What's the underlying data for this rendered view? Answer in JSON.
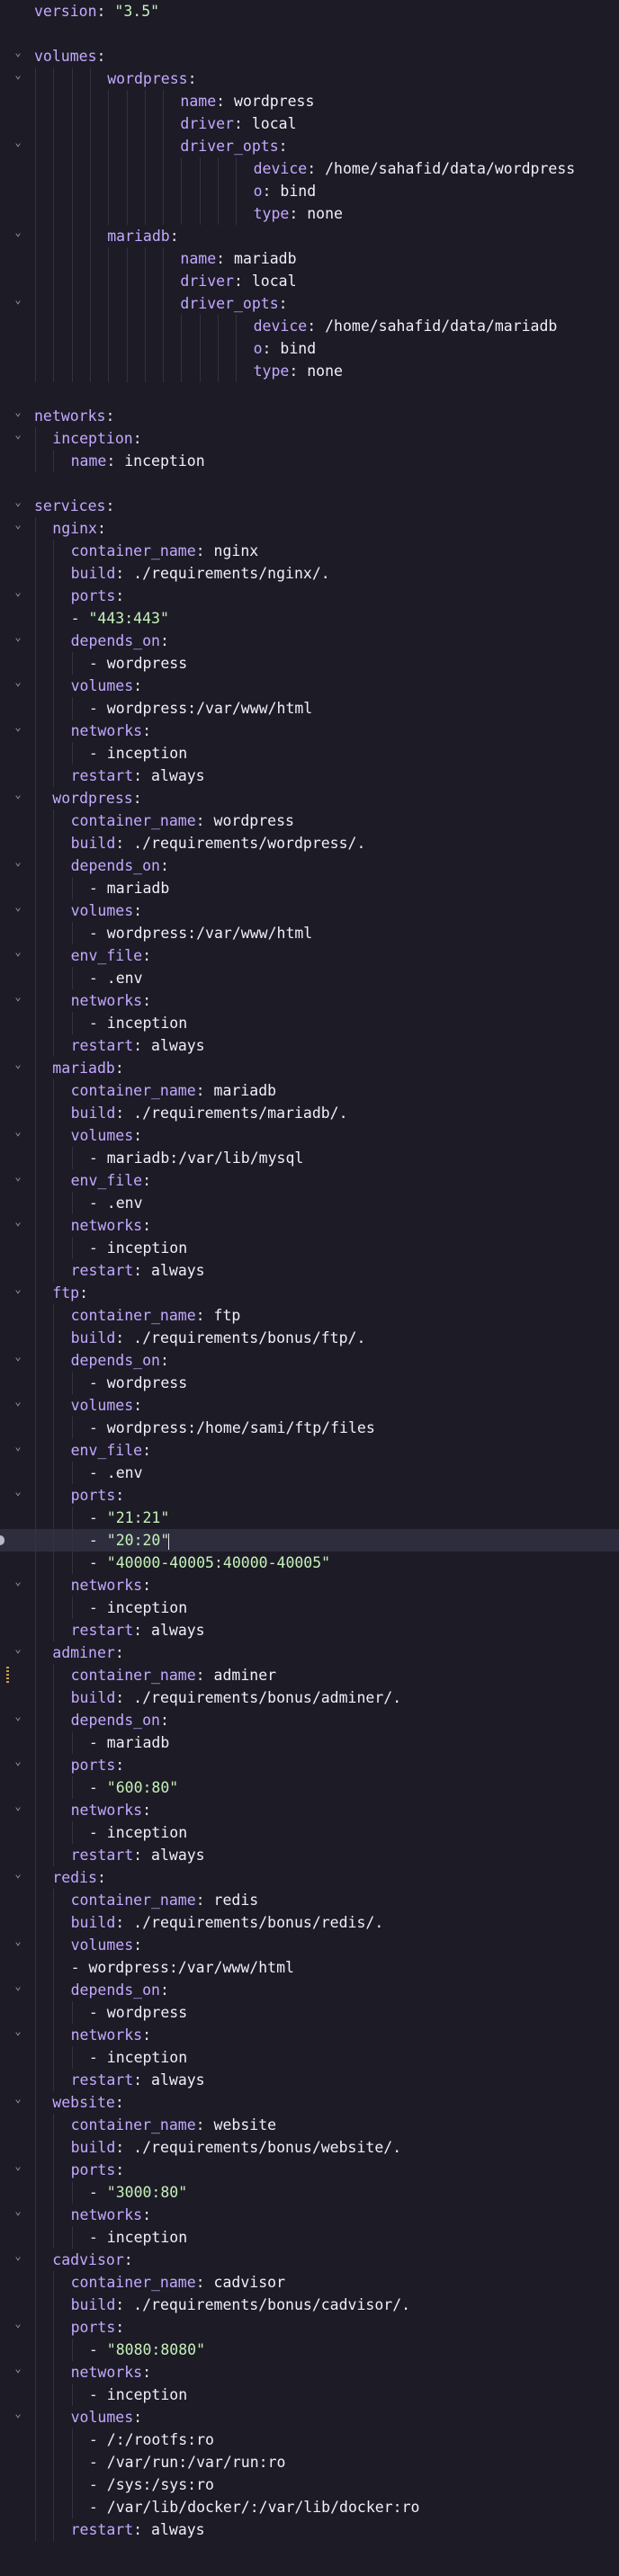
{
  "lines": [
    {
      "k": "version",
      "s": "\"3.5\""
    },
    {},
    {
      "k": "volumes",
      "fold": true
    },
    {
      "depth": 4,
      "k": "wordpress",
      "fold": true
    },
    {
      "depth": 8,
      "k": "name",
      "v": "wordpress"
    },
    {
      "depth": 8,
      "k": "driver",
      "v": "local"
    },
    {
      "depth": 8,
      "k": "driver_opts",
      "fold": true
    },
    {
      "depth": 12,
      "k": "device",
      "v": "/home/sahafid/data/wordpress"
    },
    {
      "depth": 12,
      "k": "o",
      "v": "bind"
    },
    {
      "depth": 12,
      "k": "type",
      "v": "none"
    },
    {
      "depth": 4,
      "k": "mariadb",
      "fold": true
    },
    {
      "depth": 8,
      "k": "name",
      "v": "mariadb"
    },
    {
      "depth": 8,
      "k": "driver",
      "v": "local"
    },
    {
      "depth": 8,
      "k": "driver_opts",
      "fold": true
    },
    {
      "depth": 12,
      "k": "device",
      "v": "/home/sahafid/data/mariadb"
    },
    {
      "depth": 12,
      "k": "o",
      "v": "bind"
    },
    {
      "depth": 12,
      "k": "type",
      "v": "none"
    },
    {},
    {
      "k": "networks",
      "fold": true
    },
    {
      "depth": 1,
      "k": "inception",
      "fold": true
    },
    {
      "depth": 2,
      "k": "name",
      "v": "inception"
    },
    {},
    {
      "k": "services",
      "fold": true
    },
    {
      "depth": 1,
      "k": "nginx",
      "fold": true
    },
    {
      "depth": 2,
      "k": "container_name",
      "v": "nginx"
    },
    {
      "depth": 2,
      "k": "build",
      "v": "./requirements/nginx/."
    },
    {
      "depth": 2,
      "k": "ports",
      "fold": true
    },
    {
      "depth": 2,
      "dash": true,
      "s": "\"443:443\""
    },
    {
      "depth": 2,
      "k": "depends_on",
      "fold": true
    },
    {
      "depth": 3,
      "dash": true,
      "v": "wordpress"
    },
    {
      "depth": 2,
      "k": "volumes",
      "fold": true
    },
    {
      "depth": 3,
      "dash": true,
      "v": "wordpress:/var/www/html"
    },
    {
      "depth": 2,
      "k": "networks",
      "fold": true
    },
    {
      "depth": 3,
      "dash": true,
      "v": "inception"
    },
    {
      "depth": 2,
      "k": "restart",
      "v": "always"
    },
    {
      "depth": 1,
      "k": "wordpress",
      "fold": true
    },
    {
      "depth": 2,
      "k": "container_name",
      "v": "wordpress"
    },
    {
      "depth": 2,
      "k": "build",
      "v": "./requirements/wordpress/."
    },
    {
      "depth": 2,
      "k": "depends_on",
      "fold": true
    },
    {
      "depth": 3,
      "dash": true,
      "v": "mariadb"
    },
    {
      "depth": 2,
      "k": "volumes",
      "fold": true
    },
    {
      "depth": 3,
      "dash": true,
      "v": "wordpress:/var/www/html"
    },
    {
      "depth": 2,
      "k": "env_file",
      "fold": true
    },
    {
      "depth": 3,
      "dash": true,
      "v": ".env"
    },
    {
      "depth": 2,
      "k": "networks",
      "fold": true
    },
    {
      "depth": 3,
      "dash": true,
      "v": "inception"
    },
    {
      "depth": 2,
      "k": "restart",
      "v": "always"
    },
    {
      "depth": 1,
      "k": "mariadb",
      "fold": true
    },
    {
      "depth": 2,
      "k": "container_name",
      "v": "mariadb"
    },
    {
      "depth": 2,
      "k": "build",
      "v": "./requirements/mariadb/."
    },
    {
      "depth": 2,
      "k": "volumes",
      "fold": true
    },
    {
      "depth": 3,
      "dash": true,
      "v": "mariadb:/var/lib/mysql"
    },
    {
      "depth": 2,
      "k": "env_file",
      "fold": true
    },
    {
      "depth": 3,
      "dash": true,
      "v": ".env"
    },
    {
      "depth": 2,
      "k": "networks",
      "fold": true
    },
    {
      "depth": 3,
      "dash": true,
      "v": "inception"
    },
    {
      "depth": 2,
      "k": "restart",
      "v": "always"
    },
    {
      "depth": 1,
      "k": "ftp",
      "fold": true
    },
    {
      "depth": 2,
      "k": "container_name",
      "v": "ftp"
    },
    {
      "depth": 2,
      "k": "build",
      "v": "./requirements/bonus/ftp/."
    },
    {
      "depth": 2,
      "k": "depends_on",
      "fold": true
    },
    {
      "depth": 3,
      "dash": true,
      "v": "wordpress"
    },
    {
      "depth": 2,
      "k": "volumes",
      "fold": true
    },
    {
      "depth": 3,
      "dash": true,
      "v": "wordpress:/home/sami/ftp/files"
    },
    {
      "depth": 2,
      "k": "env_file",
      "fold": true
    },
    {
      "depth": 3,
      "dash": true,
      "v": ".env"
    },
    {
      "depth": 2,
      "k": "ports",
      "fold": true
    },
    {
      "depth": 3,
      "dash": true,
      "s": "\"21:21\""
    },
    {
      "depth": 3,
      "dash": true,
      "s": "\"20:20\"",
      "current": true
    },
    {
      "depth": 3,
      "dash": true,
      "s": "\"40000-40005:40000-40005\""
    },
    {
      "depth": 2,
      "k": "networks",
      "fold": true
    },
    {
      "depth": 3,
      "dash": true,
      "v": "inception"
    },
    {
      "depth": 2,
      "k": "restart",
      "v": "always"
    },
    {
      "depth": 1,
      "k": "adminer",
      "fold": true
    },
    {
      "depth": 2,
      "k": "container_name",
      "v": "adminer",
      "mark": true
    },
    {
      "depth": 2,
      "k": "build",
      "v": "./requirements/bonus/adminer/."
    },
    {
      "depth": 2,
      "k": "depends_on",
      "fold": true
    },
    {
      "depth": 3,
      "dash": true,
      "v": "mariadb"
    },
    {
      "depth": 2,
      "k": "ports",
      "fold": true
    },
    {
      "depth": 3,
      "dash": true,
      "s": "\"600:80\""
    },
    {
      "depth": 2,
      "k": "networks",
      "fold": true
    },
    {
      "depth": 3,
      "dash": true,
      "v": "inception"
    },
    {
      "depth": 2,
      "k": "restart",
      "v": "always"
    },
    {
      "depth": 1,
      "k": "redis",
      "fold": true
    },
    {
      "depth": 2,
      "k": "container_name",
      "v": "redis"
    },
    {
      "depth": 2,
      "k": "build",
      "v": "./requirements/bonus/redis/."
    },
    {
      "depth": 2,
      "k": "volumes",
      "fold": true
    },
    {
      "depth": 2,
      "dash": true,
      "v": "wordpress:/var/www/html"
    },
    {
      "depth": 2,
      "k": "depends_on",
      "fold": true
    },
    {
      "depth": 3,
      "dash": true,
      "v": "wordpress"
    },
    {
      "depth": 2,
      "k": "networks",
      "fold": true
    },
    {
      "depth": 3,
      "dash": true,
      "v": "inception"
    },
    {
      "depth": 2,
      "k": "restart",
      "v": "always"
    },
    {
      "depth": 1,
      "k": "website",
      "fold": true
    },
    {
      "depth": 2,
      "k": "container_name",
      "v": "website"
    },
    {
      "depth": 2,
      "k": "build",
      "v": "./requirements/bonus/website/."
    },
    {
      "depth": 2,
      "k": "ports",
      "fold": true
    },
    {
      "depth": 3,
      "dash": true,
      "s": "\"3000:80\""
    },
    {
      "depth": 2,
      "k": "networks",
      "fold": true
    },
    {
      "depth": 3,
      "dash": true,
      "v": "inception"
    },
    {
      "depth": 1,
      "k": "cadvisor",
      "fold": true
    },
    {
      "depth": 2,
      "k": "container_name",
      "v": "cadvisor"
    },
    {
      "depth": 2,
      "k": "build",
      "v": "./requirements/bonus/cadvisor/."
    },
    {
      "depth": 2,
      "k": "ports",
      "fold": true
    },
    {
      "depth": 3,
      "dash": true,
      "s": "\"8080:8080\""
    },
    {
      "depth": 2,
      "k": "networks",
      "fold": true
    },
    {
      "depth": 3,
      "dash": true,
      "v": "inception"
    },
    {
      "depth": 2,
      "k": "volumes",
      "fold": true
    },
    {
      "depth": 3,
      "dash": true,
      "v": "/:/rootfs:ro"
    },
    {
      "depth": 3,
      "dash": true,
      "v": "/var/run:/var/run:ro"
    },
    {
      "depth": 3,
      "dash": true,
      "v": "/sys:/sys:ro"
    },
    {
      "depth": 3,
      "dash": true,
      "v": "/var/lib/docker/:/var/lib/docker:ro"
    },
    {
      "depth": 2,
      "k": "restart",
      "v": "always"
    }
  ]
}
